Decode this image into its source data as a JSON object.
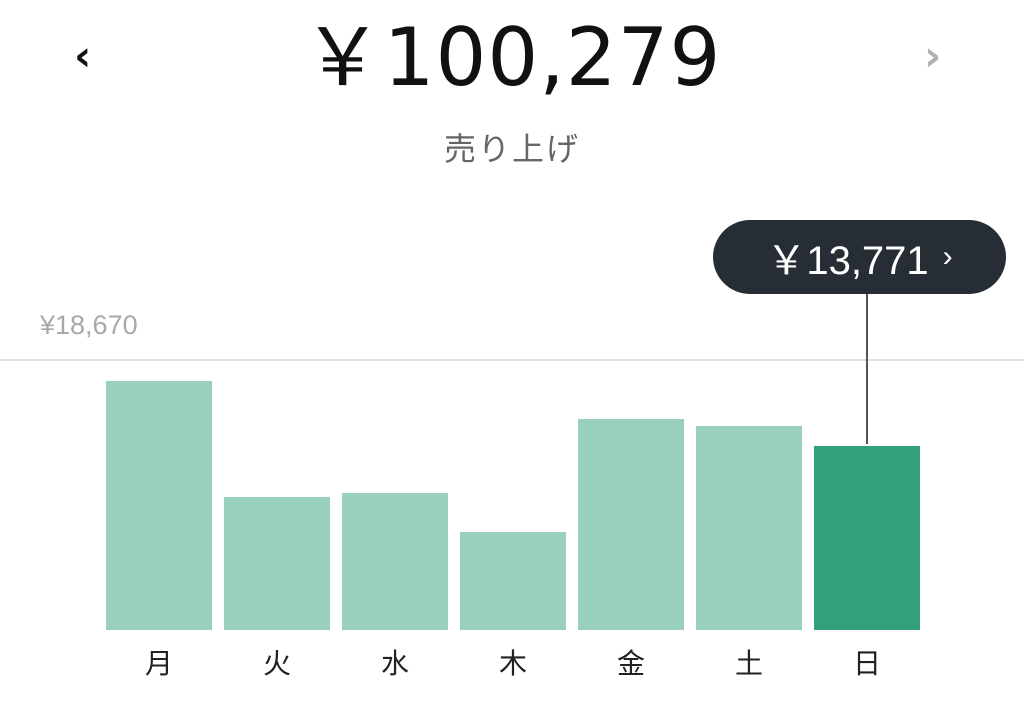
{
  "header": {
    "prev_icon": "‹",
    "next_icon": "›",
    "total": "￥100,279",
    "subtitle": "売り上げ"
  },
  "colors": {
    "bar": "#99cfbe",
    "bar_selected": "#33a07d",
    "tooltip_bg": "#262d35",
    "next_disabled": "#b0b0b0"
  },
  "tooltip": {
    "value": "￥13,771",
    "chevron": "›"
  },
  "chart_data": {
    "type": "bar",
    "categories": [
      "月",
      "火",
      "水",
      "木",
      "金",
      "土",
      "日"
    ],
    "values": [
      18670,
      9960,
      10300,
      7380,
      15820,
      15270,
      13771
    ],
    "reference_line": {
      "label": "¥18,670",
      "value": 18670
    },
    "selected_index": 6,
    "ylim": [
      0,
      18670
    ],
    "grid": false
  }
}
